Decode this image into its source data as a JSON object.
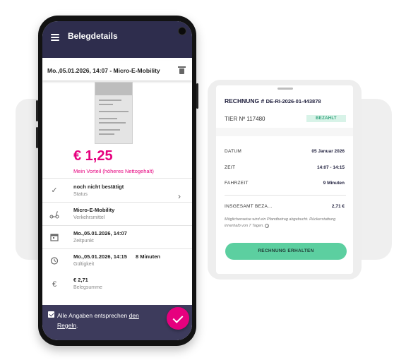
{
  "app": {
    "title": "Belegdetails",
    "subheader": "Mo.,05.01.2026, 14:07 - Micro-E-Mobility",
    "price": "€ 1,25",
    "advantage": "Mein Vorteil (höheres Nettogehalt)",
    "rows": [
      {
        "icon": "check-icon",
        "title": "noch nicht bestätigt",
        "sub": "Status",
        "extra": ""
      },
      {
        "icon": "scooter-icon",
        "title": "Micro-E-Mobility",
        "sub": "Verkehrsmittel",
        "extra": ""
      },
      {
        "icon": "calendar-icon",
        "title": "Mo.,05.01.2026, 14:07",
        "sub": "Zeitpunkt",
        "extra": ""
      },
      {
        "icon": "timer-icon",
        "title": "Mo.,05.01.2026, 14:15",
        "sub": "Gültigkeit",
        "extra": "8 Minuten"
      },
      {
        "icon": "euro-icon",
        "title": "€ 2,71",
        "sub": "Belegsumme",
        "extra": ""
      }
    ],
    "footer": {
      "text_before": "Alle Angaben entsprechen ",
      "link_part1": "den",
      "link_part2": "Regeln",
      "text_after": ".",
      "checked": true
    },
    "accent_color": "#e6007e",
    "appbar_color": "#2e2d4d"
  },
  "receipt_card": {
    "title_label": "RECHNUNG #",
    "number": "DE-RI-2026-01-443878",
    "tier": "TIER Nº 117480",
    "status_badge": "BEZAHLT",
    "fields": [
      {
        "label": "DATUM",
        "value": "05 Januar 2026"
      },
      {
        "label": "ZEIT",
        "value": "14:07 - 14:15"
      },
      {
        "label": "FAHRZEIT",
        "value": "9 Minuten"
      }
    ],
    "total_label": "INSGESAMT BEZA...",
    "total_value": "2,71 €",
    "note": "Möglicherweise wird ein Pfandbetrag abgebucht. Rückerstattung innerhalb von 7 Tagen.",
    "cta_label": "RECHNUNG ERHALTEN",
    "cta_color": "#5ccfa0"
  }
}
